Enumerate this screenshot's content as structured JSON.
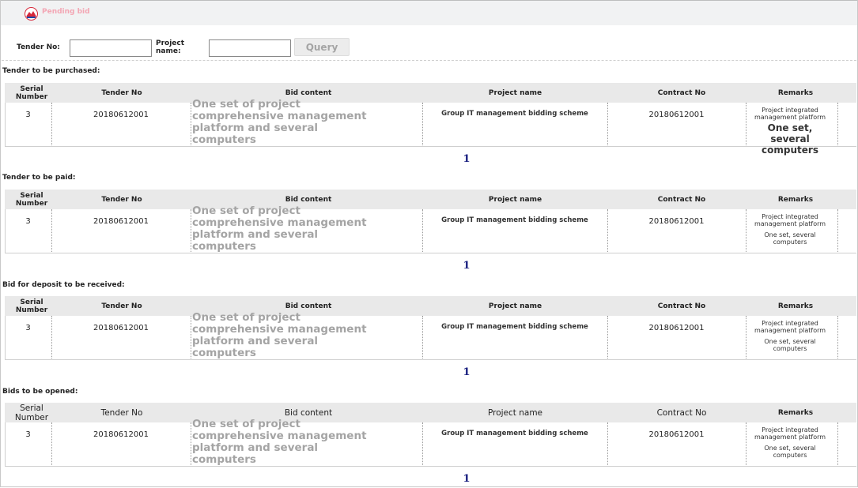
{
  "app": {
    "title": "Pending bid",
    "logo_icon": "mountain-logo-icon"
  },
  "query": {
    "tender_label": "Tender No:",
    "project_label": "Project name:",
    "tender_value": "",
    "project_value": "",
    "button": "Query"
  },
  "columns": [
    "Serial Number",
    "Tender No",
    "Bid content",
    "Project name",
    "Contract No",
    "Remarks"
  ],
  "sections": [
    {
      "title": "Tender to be purchased:",
      "rows": [
        {
          "serial": "3",
          "tender_no": "20180612001",
          "bid_content": "One set of project comprehensive management platform and several computers",
          "project_name": "Group IT management bidding scheme",
          "contract_no": "20180612001",
          "remarks_1": "Project integrated management platform",
          "remarks_2": "One set, several computers"
        }
      ],
      "page": "1"
    },
    {
      "title": "Tender to be paid:",
      "rows": [
        {
          "serial": "3",
          "tender_no": "20180612001",
          "bid_content": "One set of project comprehensive management platform and several computers",
          "project_name": "Group IT management bidding scheme",
          "contract_no": "20180612001",
          "remarks_1": "Project integrated management platform",
          "remarks_2": "One set, several computers"
        }
      ],
      "page": "1"
    },
    {
      "title": "Bid for deposit to be received:",
      "rows": [
        {
          "serial": "3",
          "tender_no": "20180612001",
          "bid_content": "One set of project comprehensive management platform and several computers",
          "project_name": "Group IT management bidding scheme",
          "contract_no": "20180612001",
          "remarks_1": "Project integrated management platform",
          "remarks_2": "One set, several computers"
        }
      ],
      "page": "1"
    },
    {
      "title": "Bids to be opened:",
      "rows": [
        {
          "serial": "3",
          "tender_no": "20180612001",
          "bid_content": "One set of project comprehensive management platform and several computers",
          "project_name": "Group IT management bidding scheme",
          "contract_no": "20180612001",
          "remarks_1": "Project integrated management platform",
          "remarks_2": "One set, several computers"
        }
      ],
      "page": "1"
    }
  ]
}
